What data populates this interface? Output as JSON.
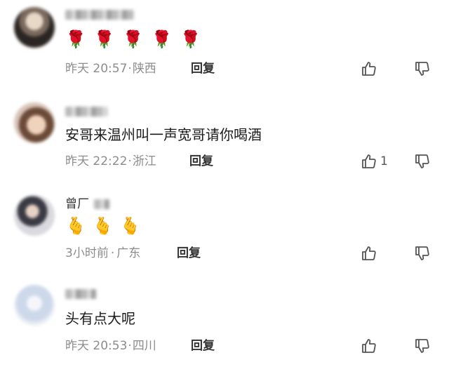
{
  "comments": [
    {
      "content": "",
      "emoji": [
        "🌹",
        "🌹",
        "🌹",
        "🌹",
        "🌹"
      ],
      "time": "昨天 20:57",
      "location": "陕西",
      "reply_label": "回复",
      "likes": ""
    },
    {
      "content": "安哥来温州叫一声宽哥请你喝酒",
      "emoji": [],
      "time": "昨天 22:22",
      "location": "浙江",
      "reply_label": "回复",
      "likes": "1"
    },
    {
      "username_visible": "曾厂",
      "content": "",
      "emoji": [
        "🫰",
        "🫰",
        "🫰"
      ],
      "time": "3小时前",
      "location": "广东",
      "reply_label": "回复",
      "likes": ""
    },
    {
      "content": "头有点大呢",
      "emoji": [],
      "time": "昨天 20:53",
      "location": "四川",
      "reply_label": "回复",
      "likes": ""
    }
  ],
  "separator": "·",
  "icons": {
    "like": "thumbs-up-icon",
    "dislike": "thumbs-down-icon"
  },
  "colors": {
    "meta_text": "#8c8c8c",
    "body_text": "#1b1b1b",
    "icon_stroke": "#555555"
  }
}
